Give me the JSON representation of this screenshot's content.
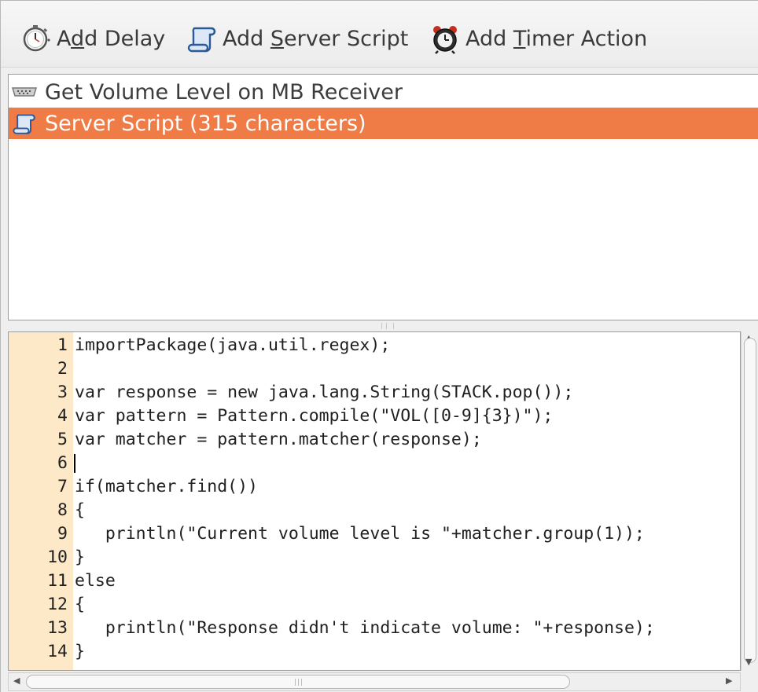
{
  "toolbar": {
    "add_delay": {
      "pre": "A",
      "acc": "d",
      "post": "d Delay",
      "icon": "stopwatch-icon"
    },
    "add_server_script": {
      "pre": "Add ",
      "acc": "S",
      "post": "erver Script",
      "icon": "scroll-icon"
    },
    "add_timer_action": {
      "pre": "Add ",
      "acc": "T",
      "post": "imer Action",
      "icon": "alarm-clock-icon"
    }
  },
  "list": {
    "items": [
      {
        "label": "Get Volume Level on MB Receiver",
        "icon": "serial-port-icon",
        "selected": false
      },
      {
        "label": "Server Script (315 characters)",
        "icon": "scroll-icon",
        "selected": true
      }
    ]
  },
  "editor": {
    "lines": [
      {
        "num": "1",
        "text": "importPackage(java.util.regex);"
      },
      {
        "num": "2",
        "text": ""
      },
      {
        "num": "3",
        "text": "var response = new java.lang.String(STACK.pop());"
      },
      {
        "num": "4",
        "text": "var pattern = Pattern.compile(\"VOL([0-9]{3})\");"
      },
      {
        "num": "5",
        "text": "var matcher = pattern.matcher(response);"
      },
      {
        "num": "6",
        "text": ""
      },
      {
        "num": "7",
        "text": "if(matcher.find())"
      },
      {
        "num": "8",
        "text": "{"
      },
      {
        "num": "9",
        "text": "   println(\"Current volume level is \"+matcher.group(1));"
      },
      {
        "num": "10",
        "text": "}"
      },
      {
        "num": "11",
        "text": "else"
      },
      {
        "num": "12",
        "text": "{"
      },
      {
        "num": "13",
        "text": "   println(\"Response didn't indicate volume: \"+response);"
      },
      {
        "num": "14",
        "text": "}"
      }
    ],
    "caret_line": "6"
  },
  "colors": {
    "selection": "#ef7c46",
    "gutter": "#fde8c7"
  }
}
